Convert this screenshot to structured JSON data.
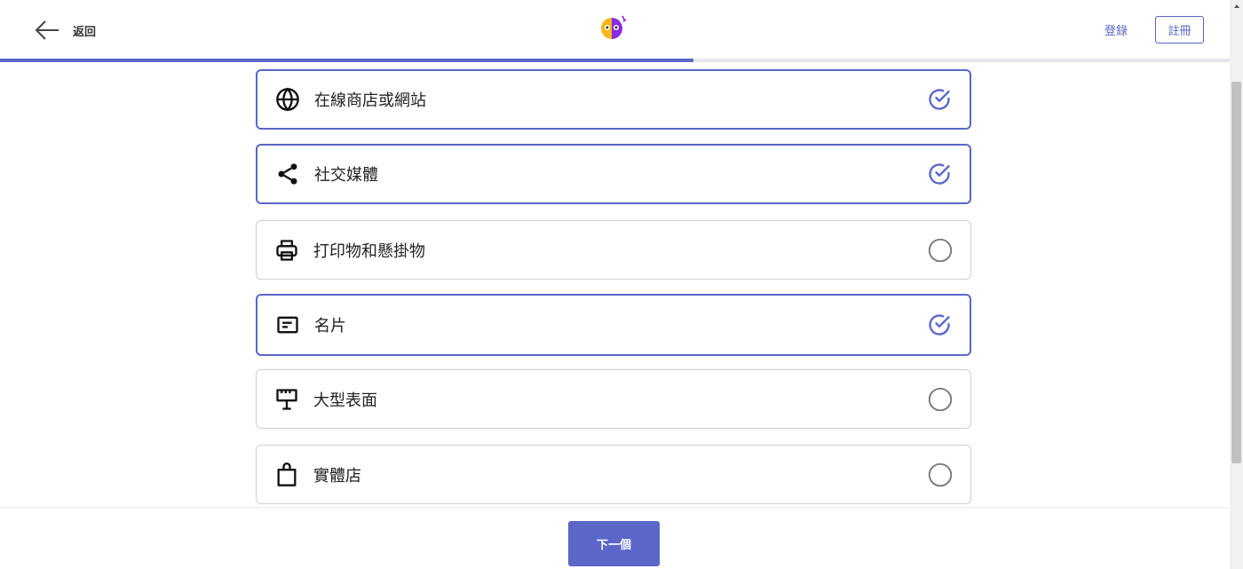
{
  "header": {
    "back_label": "返回",
    "login_label": "登錄",
    "register_label": "註冊",
    "progress_fraction": 0.564
  },
  "options": [
    {
      "label": "在線商店或網站",
      "icon": "globe-icon",
      "selected": true
    },
    {
      "label": "社交媒體",
      "icon": "share-icon",
      "selected": true
    },
    {
      "label": "打印物和懸掛物",
      "icon": "printer-icon",
      "selected": false
    },
    {
      "label": "名片",
      "icon": "business-card-icon",
      "selected": true
    },
    {
      "label": "大型表面",
      "icon": "billboard-icon",
      "selected": false
    },
    {
      "label": "實體店",
      "icon": "shopping-bag-icon",
      "selected": false
    }
  ],
  "footer": {
    "next_label": "下一個"
  },
  "colors": {
    "accent": "#5a66c8",
    "logo_yellow": "#f5b818",
    "logo_purple": "#8a2be2"
  }
}
